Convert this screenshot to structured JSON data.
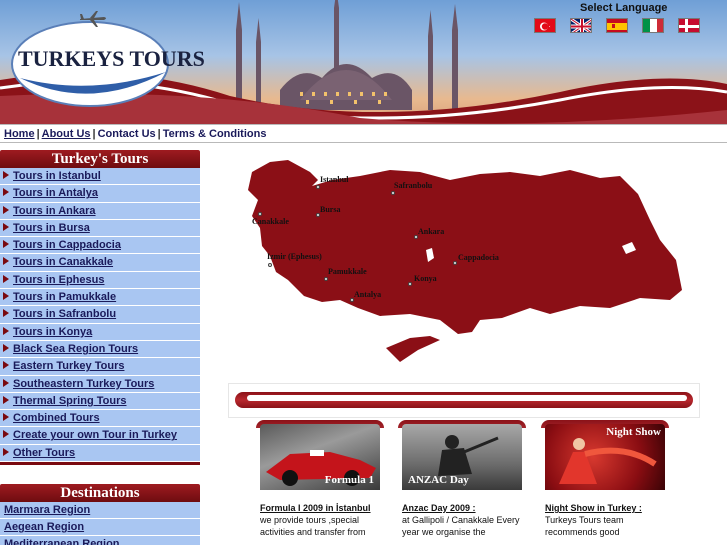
{
  "header": {
    "logo_text": "TURKEYS TOURS",
    "language_label": "Select Language",
    "flags": [
      {
        "name": "turkish",
        "colors": [
          "#e30a17",
          "#ffffff"
        ]
      },
      {
        "name": "english",
        "colors": [
          "#012169",
          "#c8102e",
          "#ffffff"
        ]
      },
      {
        "name": "spanish",
        "colors": [
          "#c60b1e",
          "#ffc400"
        ]
      },
      {
        "name": "italian",
        "colors": [
          "#009246",
          "#ffffff",
          "#ce2b37"
        ]
      },
      {
        "name": "danish",
        "colors": [
          "#c60c30",
          "#ffffff"
        ]
      }
    ]
  },
  "nav": {
    "items": [
      "Home",
      "About Us",
      "Contact Us",
      "Terms & Conditions"
    ],
    "separator": "|"
  },
  "sidebar": {
    "title": "Turkey's Tours",
    "items": [
      "Tours in Istanbul",
      "Tours in Antalya",
      "Tours in Ankara",
      "Tours in Bursa",
      "Tours in Cappadocia",
      "Tours in Canakkale",
      "Tours in Ephesus",
      "Tours in Pamukkale",
      "Tours in Safranbolu",
      "Tours in Konya",
      "Black Sea Region Tours",
      "Eastern Turkey Tours",
      "Southeastern Turkey Tours",
      "Thermal Spring Tours",
      "Combined Tours",
      "Create your own Tour in Turkey",
      "Other Tours"
    ]
  },
  "destinations": {
    "title": "Destinations",
    "items": [
      "Marmara Region",
      "Aegean Region",
      "Mediterranean Region"
    ]
  },
  "map": {
    "cities": [
      "Istanbul",
      "Safranbolu",
      "Bursa",
      "Canakkale",
      "Ankara",
      "Izmir (Ephesus)",
      "Cappadocia",
      "Pamukkale",
      "Konya",
      "Antalya"
    ],
    "land_color": "#8b0f16"
  },
  "cards": [
    {
      "image_label": "Formula 1",
      "title": "Formula I 2009 in İstanbul",
      "text": "we provide tours ,special activities and transfer from"
    },
    {
      "image_label": "ANZAC Day",
      "title": "Anzac Day 2009 :",
      "text": "at Gallipoli / Canakkale Every year we organise the"
    },
    {
      "image_label": "Night Show",
      "title": "Night Show in Turkey :",
      "text": "Turkeys Tours team recommends good"
    }
  ],
  "colors": {
    "accent": "#8b1218",
    "sidebar_bg": "#a9c6f2",
    "link": "#1a1a5a"
  }
}
